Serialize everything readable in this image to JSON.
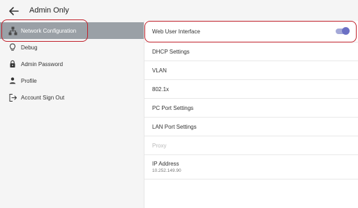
{
  "header": {
    "title": "Admin Only"
  },
  "sidebar": {
    "items": [
      {
        "label": "Network Configuration",
        "icon": "network-icon",
        "active": true
      },
      {
        "label": "Debug",
        "icon": "lightbulb-icon"
      },
      {
        "label": "Admin Password",
        "icon": "lock-icon"
      },
      {
        "label": "Profile",
        "icon": "person-icon"
      },
      {
        "label": "Account Sign Out",
        "icon": "sign-out-icon"
      }
    ]
  },
  "main": {
    "rows": [
      {
        "label": "Web User Interface",
        "toggle": true
      },
      {
        "label": "DHCP Settings"
      },
      {
        "label": "VLAN"
      },
      {
        "label": "802.1x"
      },
      {
        "label": "PC Port Settings"
      },
      {
        "label": "LAN Port Settings"
      },
      {
        "label": "Proxy",
        "disabled": true
      },
      {
        "label": "IP Address",
        "value": "10.252.149.90"
      }
    ]
  },
  "colors": {
    "accent": "#6b70c4",
    "active_item": "#9aa0a6",
    "highlight": "#c0202a"
  }
}
